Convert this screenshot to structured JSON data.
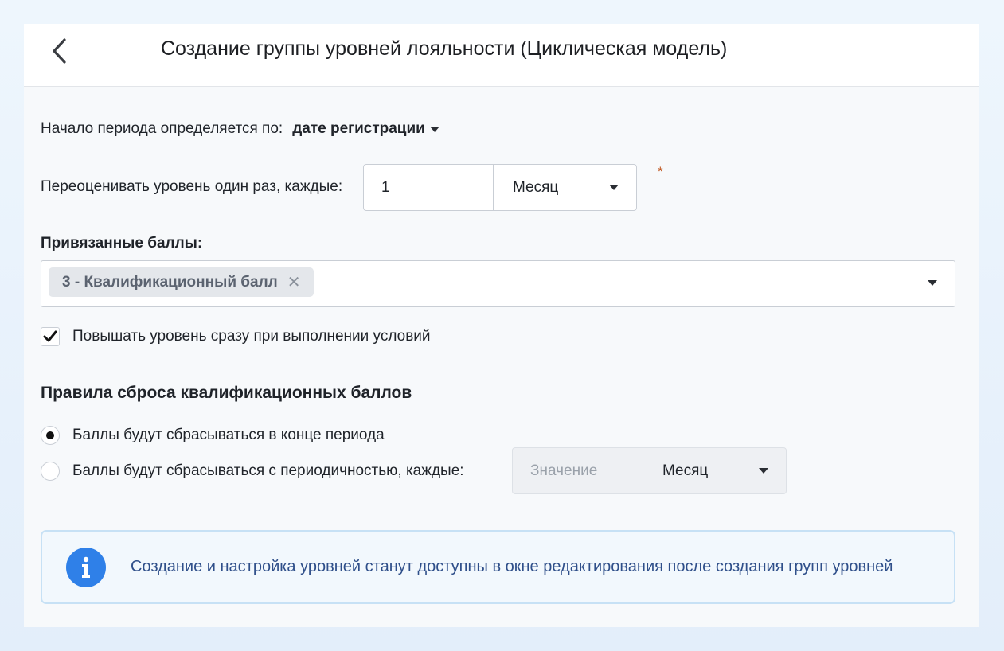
{
  "header": {
    "title": "Создание группы уровней лояльности (Циклическая модель)"
  },
  "period_start": {
    "label": "Начало периода определяется по:",
    "value": "дате регистрации"
  },
  "reevaluate": {
    "label": "Переоценивать уровень один раз, каждые:",
    "count_value": "1",
    "unit_value": "Месяц",
    "required_mark": "*"
  },
  "linked_points": {
    "label": "Привязанные баллы:",
    "selected": [
      {
        "label": "3 - Квалификационный балл"
      }
    ]
  },
  "instant_upgrade": {
    "label": "Повышать уровень сразу при выполнении условий",
    "checked": true
  },
  "reset_rules": {
    "title": "Правила сброса квалификационных баллов",
    "options": [
      {
        "label": "Баллы будут сбрасываться в конце периода",
        "selected": true
      },
      {
        "label": "Баллы будут сбрасываться с периодичностью, каждые:",
        "selected": false
      }
    ],
    "periodic_value_placeholder": "Значение",
    "periodic_unit_value": "Месяц"
  },
  "info": {
    "text": "Создание и настройка уровней станут доступны в окне редактирования после создания групп уровней"
  },
  "colors": {
    "accent": "#2f80e8",
    "info_text": "#2f4f8a",
    "required": "#c0561f"
  }
}
